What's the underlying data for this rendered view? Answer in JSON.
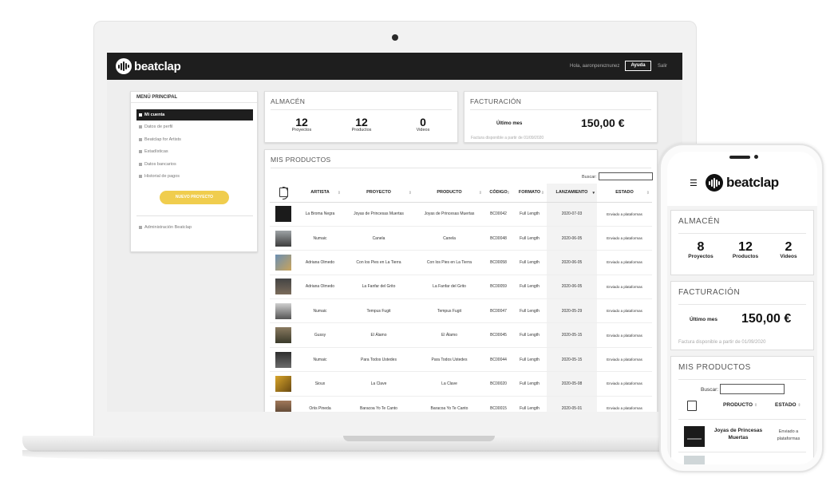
{
  "brand": {
    "name": "beatclap"
  },
  "topbar": {
    "greeting": "Hola, aaronpereznunez",
    "help_label": "Ayuda",
    "logout_label": "Salir"
  },
  "sidebar": {
    "title": "MENÚ PRINCIPAL",
    "items": [
      {
        "label": "Mi cuenta",
        "active": true
      },
      {
        "label": "Datos de perfil"
      },
      {
        "label": "Beatclap for Artists"
      },
      {
        "label": "Estadísticas"
      },
      {
        "label": "Datos bancarios"
      },
      {
        "label": "Historial de pagos"
      }
    ],
    "new_project_label": "NUEVO PROYECTO",
    "admin_label": "Administración Beatclap"
  },
  "almacen": {
    "title": "ALMACÉN",
    "stats": [
      {
        "value": "12",
        "label": "Proyectos"
      },
      {
        "value": "12",
        "label": "Productos"
      },
      {
        "value": "0",
        "label": "Videos"
      }
    ]
  },
  "facturacion": {
    "title": "FACTURACIÓN",
    "label": "Último mes",
    "amount": "150,00 €",
    "note": "Factura disponible a partir de 01/09/2020"
  },
  "productos": {
    "title": "MIS PRODUCTOS",
    "search_label": "Buscar:",
    "columns": [
      "ARTISTA",
      "PROYECTO",
      "PRODUCTO",
      "CÓDIGO",
      "FORMATO",
      "LANZAMIENTO",
      "ESTADO"
    ],
    "rows": [
      {
        "artista": "La Broma Negra",
        "proyecto": "Joyas de Princesas Muertas",
        "producto": "Joyas de Princesas Muertas",
        "codigo": "BC00042",
        "formato": "Full Length",
        "lanzamiento": "2020-07-03",
        "estado": "Enviado a plataformas"
      },
      {
        "artista": "Numaic",
        "proyecto": "Canela",
        "producto": "Canela",
        "codigo": "BC00048",
        "formato": "Full Length",
        "lanzamiento": "2020-06-05",
        "estado": "Enviado a plataformas"
      },
      {
        "artista": "Adriana Olmedo",
        "proyecto": "Con los Pies en La Tierra",
        "producto": "Con los Pies en La Tierra",
        "codigo": "BC00058",
        "formato": "Full Length",
        "lanzamiento": "2020-06-05",
        "estado": "Enviado a plataformas"
      },
      {
        "artista": "Adriana Olmedo",
        "proyecto": "La Fanfar del Grito",
        "producto": "La Fanfar del Grito",
        "codigo": "BC00059",
        "formato": "Full Length",
        "lanzamiento": "2020-06-05",
        "estado": "Enviado a plataformas"
      },
      {
        "artista": "Numaic",
        "proyecto": "Tempus Fugit",
        "producto": "Tempus Fugit",
        "codigo": "BC00047",
        "formato": "Full Length",
        "lanzamiento": "2020-05-29",
        "estado": "Enviado a plataformas"
      },
      {
        "artista": "Gussy",
        "proyecto": "El Álamo",
        "producto": "El Álamo",
        "codigo": "BC00045",
        "formato": "Full Length",
        "lanzamiento": "2020-05-15",
        "estado": "Enviado a plataformas"
      },
      {
        "artista": "Numaic",
        "proyecto": "Para Todos Ustedes",
        "producto": "Para Todos Ustedes",
        "codigo": "BC00044",
        "formato": "Full Length",
        "lanzamiento": "2020-05-15",
        "estado": "Enviado a plataformas"
      },
      {
        "artista": "Sioux",
        "proyecto": "La Clave",
        "producto": "La Clave",
        "codigo": "BC00020",
        "formato": "Full Length",
        "lanzamiento": "2020-05-08",
        "estado": "Enviado a plataformas"
      },
      {
        "artista": "Oriis Pineda",
        "proyecto": "Baracoa Yo Te Canto",
        "producto": "Baracoa Yo Te Canto",
        "codigo": "BC00015",
        "formato": "Full Length",
        "lanzamiento": "2020-05-01",
        "estado": "Enviado a plataformas"
      }
    ]
  },
  "mobile": {
    "almacen": {
      "title": "ALMACÉN",
      "stats": [
        {
          "value": "8",
          "label": "Proyectos"
        },
        {
          "value": "12",
          "label": "Productos"
        },
        {
          "value": "2",
          "label": "Videos"
        }
      ]
    },
    "facturacion": {
      "title": "FACTURACIÓN",
      "label": "Último mes",
      "amount": "150,00 €",
      "note": "Factura disponible a partir de 01/09/2020"
    },
    "productos": {
      "title": "MIS PRODUCTOS",
      "search_label": "Buscar:",
      "columns": [
        "PRODUCTO",
        "ESTADO"
      ],
      "rows": [
        {
          "producto": "Joyas de Princesas Muertas",
          "estado": "Enviado a plataformas"
        }
      ]
    }
  },
  "icons": [
    "beatclap-logo-icon",
    "menu-icon",
    "cover-art-icon",
    "sort-icon",
    "sidebar-bullet-icon"
  ],
  "colors": {
    "topbar": "#1e1e1e",
    "accent": "#f0cd4e",
    "background": "#eeeeee"
  }
}
